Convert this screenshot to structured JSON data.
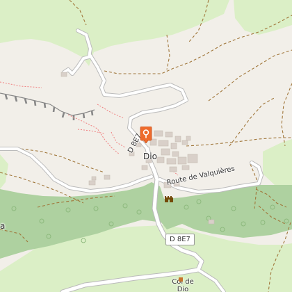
{
  "map": {
    "place_labels": {
      "village": "Dio",
      "pass_line1": "Col de",
      "pass_line2": "Dio",
      "edge_fragment": "a"
    },
    "road_labels": {
      "d8e7_north": "D 8E7",
      "d8e7_south": "D 8E7",
      "route_valquieres": "Route de Valquières"
    },
    "markers": {
      "selected_poi_icon": "map-pin-icon",
      "selected_poi_color": "#ee6b2d"
    },
    "pois": {
      "village_icon": "castle-icon",
      "pass_icon": "mountain-pass-icon"
    },
    "colors": {
      "land": "#f2efe9",
      "meadow": "#dbefc6",
      "forest": "#aed1a0",
      "road": "#ffffff",
      "road_casing": "#bbbbbb",
      "track": "#a0763a",
      "footpath": "#f08080",
      "building": "#d9d0c9",
      "cliff": "#888888"
    }
  }
}
